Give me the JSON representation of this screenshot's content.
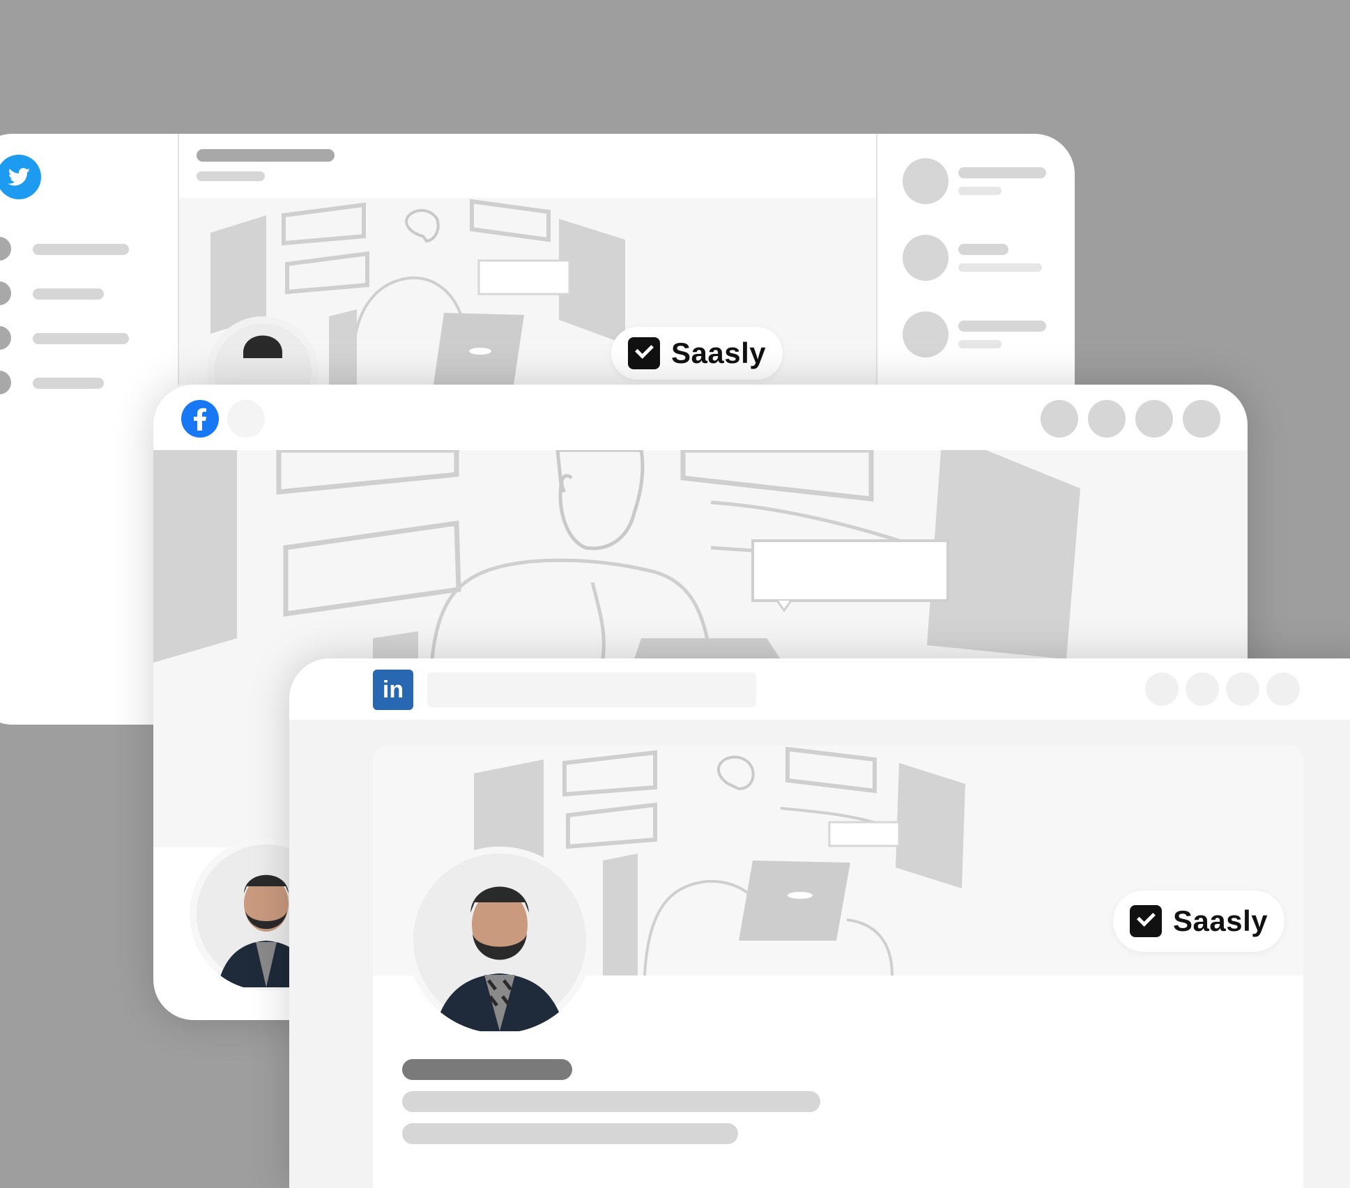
{
  "brand": {
    "name": "Saasly"
  },
  "colors": {
    "background": "#9e9e9e",
    "twitter_blue": "#1d9bf0",
    "facebook_blue": "#1877f2",
    "linkedin_blue": "#2867b2",
    "skeleton_light": "#d6d6d6",
    "skeleton_dark": "#7a7a7a"
  },
  "twitter_card": {
    "icon": "twitter-bird-icon",
    "nav_item_count": 4,
    "suggestion_count": 3
  },
  "facebook_card": {
    "icon": "facebook-f-icon",
    "header_action_count": 4
  },
  "linkedin_card": {
    "icon": "linkedin-in-icon",
    "icon_text": "in",
    "header_action_count": 4
  }
}
